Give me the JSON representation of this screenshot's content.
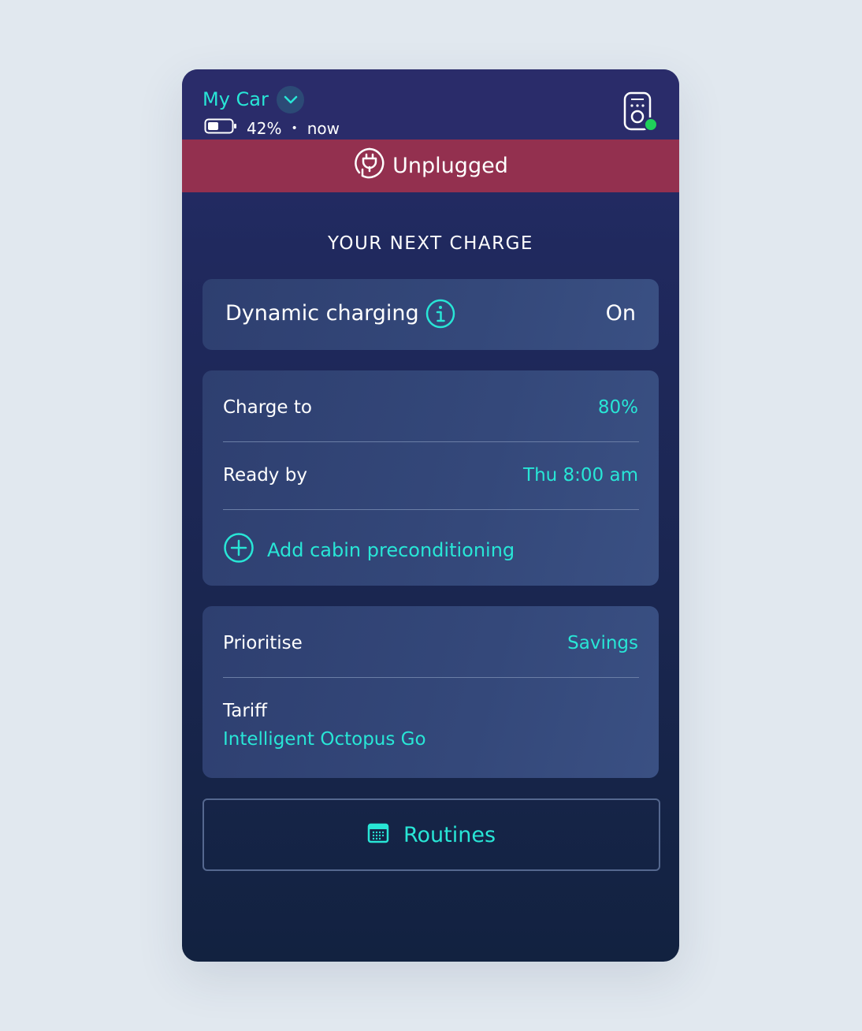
{
  "header": {
    "car_name": "My Car",
    "battery_percent": "42%",
    "separator": "•",
    "updated": "now",
    "battery_level": 0.42
  },
  "status_banner": {
    "label": "Unplugged",
    "color": "#93304f"
  },
  "section_title": "YOUR NEXT CHARGE",
  "dynamic_charging": {
    "label": "Dynamic charging",
    "value": "On"
  },
  "charge_card": {
    "charge_to_label": "Charge to",
    "charge_to_value": "80%",
    "ready_by_label": "Ready by",
    "ready_by_value": "Thu 8:00 am",
    "add_cabin_label": "Add cabin preconditioning"
  },
  "priority_card": {
    "prioritise_label": "Prioritise",
    "prioritise_value": "Savings",
    "tariff_label": "Tariff",
    "tariff_value": "Intelligent Octopus Go"
  },
  "routines_button": {
    "label": "Routines"
  },
  "colors": {
    "accent": "#28e6d6",
    "status_online": "#1fd15a",
    "background": "#e1e8ef"
  },
  "icons": {
    "chevron": "chevron-down-icon",
    "battery": "battery-icon",
    "charger": "charger-icon",
    "plug": "plug-icon",
    "info": "info-icon",
    "add": "plus-circle-icon",
    "calendar": "calendar-icon"
  }
}
